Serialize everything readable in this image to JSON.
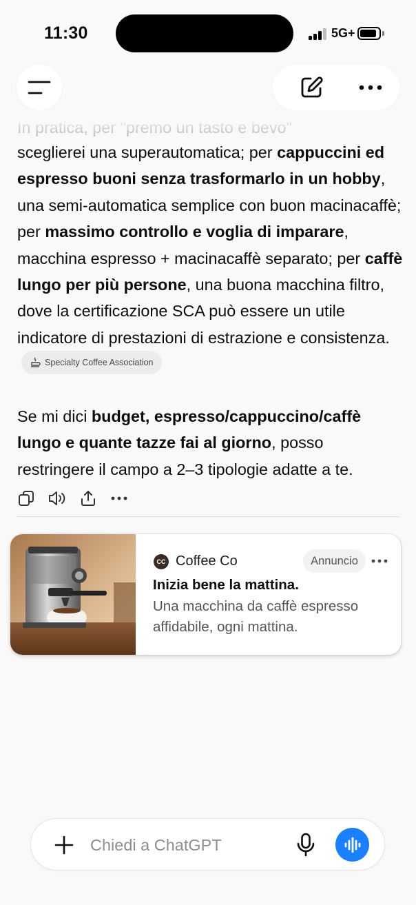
{
  "status_bar": {
    "time": "11:30",
    "network": "5G+",
    "signal_bars_filled": 3,
    "signal_bars_total": 4,
    "battery_level": 0.9
  },
  "header": {
    "menu_icon": "menu-icon",
    "new_chat_icon": "edit-icon",
    "more_icon": "more-icon"
  },
  "message": {
    "faded_line": "In pratica, per \"premo un tasto e bevo\"",
    "paragraph1": {
      "t1": "sceglierei una superautomatica; per ",
      "b1": "cappuccini ed espresso buoni senza trasformarlo in un hobby",
      "t2": ", una semi-automatica semplice con buon macinacaffè; per ",
      "b2": "massimo controllo e voglia di imparare",
      "t3": ", macchina espresso + macinacaffè separato; per ",
      "b3": "caffè lungo per più persone",
      "t4": ", una buona macchina filtro, dove la certificazione SCA può essere un utile indicatore di prestazioni di estrazione e consistenza.",
      "source_chip": "Specialty Coffee Association"
    },
    "paragraph2": {
      "t1": "Se mi dici ",
      "b1": "budget, espresso/cappuccino/caffè lungo e quante tazze fai al giorno",
      "t2": ", posso restringere il campo a 2–3 tipologie adatte a te."
    },
    "actions": [
      "copy-icon",
      "read-aloud-icon",
      "share-icon",
      "more-icon"
    ]
  },
  "ad": {
    "brand_logo_text": "CC",
    "brand_name": "Coffee Co",
    "badge": "Annuncio",
    "title": "Inizia bene la mattina.",
    "body": "Una macchina da caffè espresso affidabile, ogni mattina.",
    "image": "espresso-machine-image"
  },
  "composer": {
    "placeholder": "Chiedi a ChatGPT",
    "value": "",
    "accent_color": "#1a80ff"
  }
}
